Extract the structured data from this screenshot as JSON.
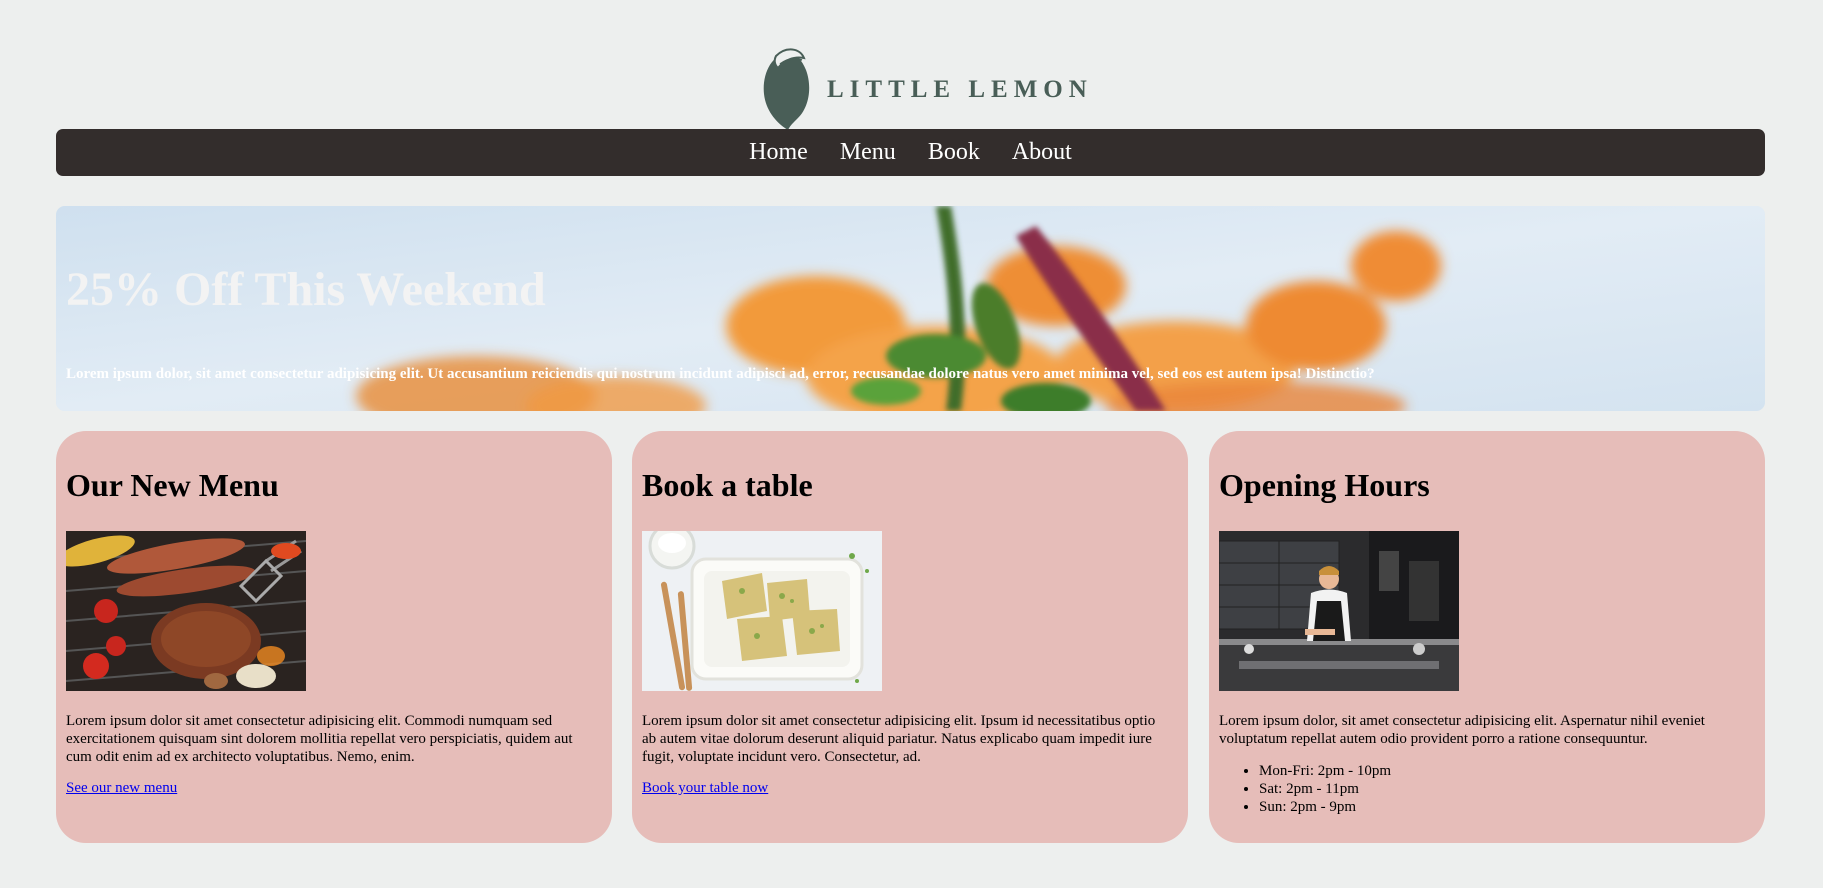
{
  "brand": {
    "name": "LITTLE LEMON",
    "logo_icon": "lemon-icon",
    "color": "#495e57"
  },
  "nav": {
    "items": [
      {
        "label": "Home"
      },
      {
        "label": "Menu"
      },
      {
        "label": "Book"
      },
      {
        "label": "About"
      }
    ],
    "background": "#332d2c"
  },
  "hero": {
    "title": "25% Off This Weekend",
    "text": "Lorem ipsum dolor, sit amet consectetur adipisicing elit. Ut accusantium reiciendis qui nostrum incidunt adipisci ad, error, recusandae dolore natus vero amet minima vel, sed eos est autem ipsa! Distinctio?"
  },
  "cards": [
    {
      "title": "Our New Menu",
      "image": "grilled-meat-image",
      "text": "Lorem ipsum dolor sit amet consectetur adipisicing elit. Commodi numquam sed exercitationem quisquam sint dolorem mollitia repellat vero perspiciatis, quidem aut cum odit enim ad ex architecto voluptatibus. Nemo, enim.",
      "link": "See our new menu"
    },
    {
      "title": "Book a table",
      "image": "food-plate-image",
      "text": "Lorem ipsum dolor sit amet consectetur adipisicing elit. Ipsum id necessitatibus optio ab autem vitae dolorum deserunt aliquid pariatur. Natus explicabo quam impedit iure fugit, voluptate incidunt vero. Consectetur, ad.",
      "link": "Book your table now"
    },
    {
      "title": "Opening Hours",
      "image": "chef-kitchen-image",
      "text": "Lorem ipsum dolor, sit amet consectetur adipisicing elit. Aspernatur nihil eveniet voluptatum repellat autem odio provident porro a ratione consequuntur.",
      "hours": [
        "Mon-Fri: 2pm - 10pm",
        "Sat: 2pm - 11pm",
        "Sun: 2pm - 9pm"
      ]
    }
  ],
  "colors": {
    "page_bg": "#edefee",
    "card_bg": "#e6bdb9",
    "link": "#0000ee"
  }
}
